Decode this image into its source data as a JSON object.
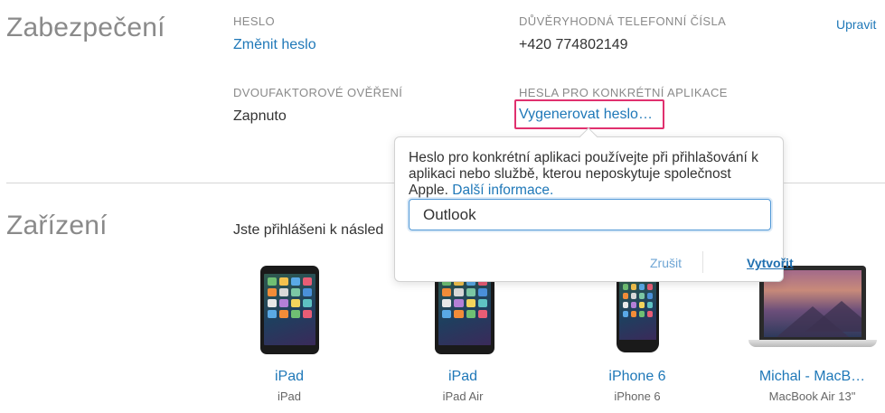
{
  "security": {
    "title": "Zabezpečení",
    "edit_label": "Upravit",
    "password_label": "HESLO",
    "password_link": "Změnit heslo",
    "trusted_label": "DŮVĚRYHODNÁ TELEFONNÍ ČÍSLA",
    "trusted_value": "+420 774802149",
    "two_factor_label": "DVOUFAKTOROVÉ OVĚŘENÍ",
    "two_factor_value": "Zapnuto",
    "app_pw_label": "HESLA PRO KONKRÉTNÍ APLIKACE",
    "app_pw_link": "Vygenerovat heslo…"
  },
  "popover": {
    "description": "Heslo pro konkrétní aplikaci používejte při přihlašování k aplikaci nebo službě, kterou neposkytuje společnost Apple.",
    "more_link": "Další informace.",
    "input_value": "Outlook",
    "cancel_label": "Zrušit",
    "create_label": "Vytvořit"
  },
  "devices": {
    "title": "Zařízení",
    "intro": "Jste přihlášeni k násled",
    "items": [
      {
        "name": "iPad",
        "model": "iPad",
        "icon": "ipad-mini-icon"
      },
      {
        "name": "iPad",
        "model": "iPad Air",
        "icon": "ipad-icon"
      },
      {
        "name": "iPhone 6",
        "model": "iPhone 6",
        "icon": "iphone-icon"
      },
      {
        "name": "Michal - MacB…",
        "model": "MacBook Air 13\"",
        "icon": "macbook-icon"
      }
    ]
  },
  "colors": {
    "link": "#1f78b8",
    "highlight": "#e0306e",
    "input_focus": "#4f97d6"
  }
}
